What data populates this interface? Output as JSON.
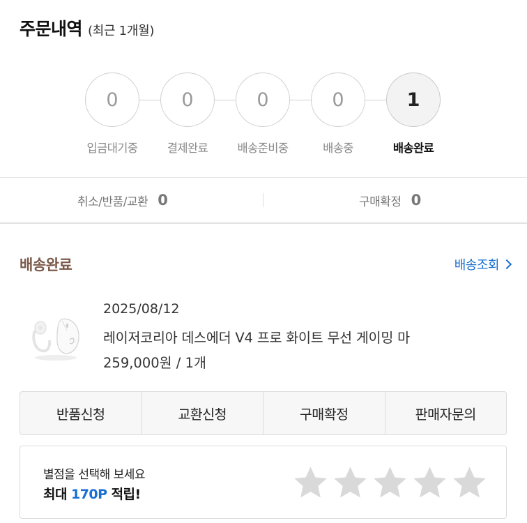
{
  "header": {
    "title": "주문내역",
    "subtitle": "(최근 1개월)"
  },
  "steps": [
    {
      "count": "0",
      "label": "입금대기중",
      "active": false
    },
    {
      "count": "0",
      "label": "결제완료",
      "active": false
    },
    {
      "count": "0",
      "label": "배송준비중",
      "active": false
    },
    {
      "count": "0",
      "label": "배송중",
      "active": false
    },
    {
      "count": "1",
      "label": "배송완료",
      "active": true
    }
  ],
  "summary": {
    "cancel_label": "취소/반품/교환",
    "cancel_count": "0",
    "confirm_label": "구매확정",
    "confirm_count": "0"
  },
  "order": {
    "status": "배송완료",
    "tracking_label": "배송조회",
    "date": "2025/08/12",
    "product_name": "레이저코리아 데스에더 V4 프로 화이트 무선 게이밍 마",
    "price_qty": "259,000원 / 1개",
    "thumbnail_icon": "wireless-mouse-icon"
  },
  "actions": [
    {
      "label": "반품신청",
      "name": "return-request-button"
    },
    {
      "label": "교환신청",
      "name": "exchange-request-button"
    },
    {
      "label": "구매확정",
      "name": "purchase-confirm-button"
    },
    {
      "label": "판매자문의",
      "name": "seller-inquiry-button"
    }
  ],
  "rating": {
    "prompt": "별점을 선택해 보세요",
    "reward_prefix": "최대",
    "reward_points": "170P",
    "reward_suffix": "적립!",
    "stars_selected": 0,
    "stars_total": 5
  },
  "colors": {
    "status_brown": "#7a5a4b",
    "link_blue": "#1a6fd1",
    "star_gray": "#d9d9d9"
  }
}
